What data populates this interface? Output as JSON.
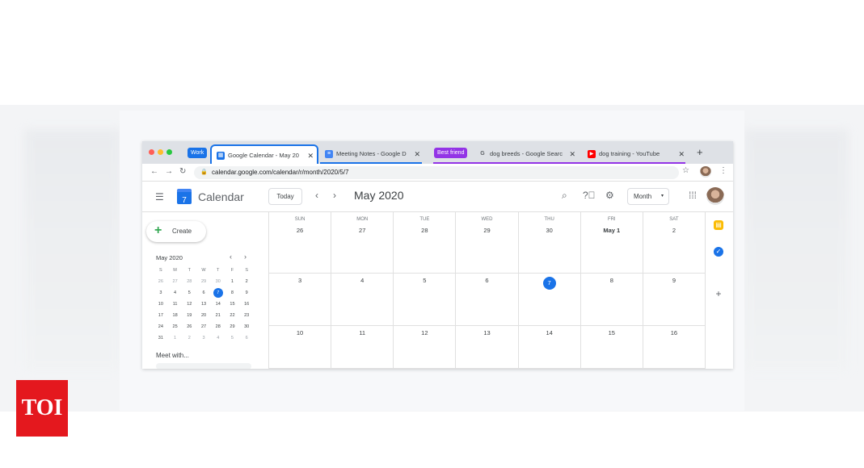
{
  "browser": {
    "tab_groups": [
      {
        "label": "Work",
        "color": "#1a73e8"
      },
      {
        "label": "Best friend",
        "color": "#9334e6"
      }
    ],
    "tabs": [
      {
        "title": "Google Calendar - May 20",
        "favicon": "calendar-icon",
        "active": true
      },
      {
        "title": "Meeting Notes - Google D",
        "favicon": "docs-icon",
        "active": false
      },
      {
        "title": "dog breeds - Google Searc",
        "favicon": "google-icon",
        "active": false
      },
      {
        "title": "dog training - YouTube",
        "favicon": "youtube-icon",
        "active": false
      }
    ],
    "new_tab": "+",
    "url": "calendar.google.com/calendar/r/month/2020/5/7"
  },
  "header": {
    "app_name": "Calendar",
    "logo_number": "7",
    "today_label": "Today",
    "month_title": "May 2020",
    "view_label": "Month"
  },
  "sidebar": {
    "create_label": "Create",
    "mini_month": "May 2020",
    "mini_dow": [
      "S",
      "M",
      "T",
      "W",
      "T",
      "F",
      "S"
    ],
    "mini_weeks": [
      [
        "26",
        "27",
        "28",
        "29",
        "30",
        "1",
        "2"
      ],
      [
        "3",
        "4",
        "5",
        "6",
        "7",
        "8",
        "9"
      ],
      [
        "10",
        "11",
        "12",
        "13",
        "14",
        "15",
        "16"
      ],
      [
        "17",
        "18",
        "19",
        "20",
        "21",
        "22",
        "23"
      ],
      [
        "24",
        "25",
        "26",
        "27",
        "28",
        "29",
        "30"
      ],
      [
        "31",
        "1",
        "2",
        "3",
        "4",
        "5",
        "6"
      ]
    ],
    "selected_day": "7",
    "meet_with": "Meet with..."
  },
  "calendar": {
    "dow": [
      "SUN",
      "MON",
      "TUE",
      "WED",
      "THU",
      "FRI",
      "SAT"
    ],
    "weeks": [
      [
        "26",
        "27",
        "28",
        "29",
        "30",
        "May 1",
        "2"
      ],
      [
        "3",
        "4",
        "5",
        "6",
        "7",
        "8",
        "9"
      ],
      [
        "10",
        "11",
        "12",
        "13",
        "14",
        "15",
        "16"
      ]
    ],
    "today": "7"
  },
  "watermark": "TOI"
}
